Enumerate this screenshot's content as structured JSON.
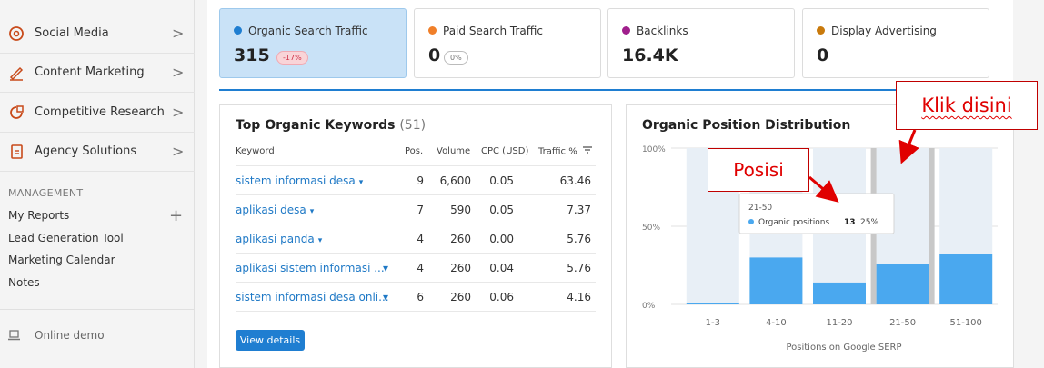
{
  "sidebar": {
    "items": [
      {
        "label": "Social Media",
        "icon": "social-media-icon",
        "chevron": ">"
      },
      {
        "label": "Content Marketing",
        "icon": "content-marketing-icon",
        "chevron": ">"
      },
      {
        "label": "Competitive Research",
        "icon": "competitive-research-icon",
        "chevron": ">"
      },
      {
        "label": "Agency Solutions",
        "icon": "agency-solutions-icon",
        "chevron": ">"
      }
    ],
    "management_label": "MANAGEMENT",
    "management_links": [
      "My Reports",
      "Lead Generation Tool",
      "Marketing Calendar",
      "Notes"
    ],
    "plus": "+",
    "online_demo": "Online demo"
  },
  "kpis": [
    {
      "label": "Organic Search Traffic",
      "value": "315",
      "change": "-17%",
      "dot_color": "#1f7ed1"
    },
    {
      "label": "Paid Search Traffic",
      "value": "0",
      "change": "0%",
      "dot_color": "#f07f29"
    },
    {
      "label": "Backlinks",
      "value": "16.4K",
      "change": "",
      "dot_color": "#a01f8c"
    },
    {
      "label": "Display Advertising",
      "value": "0",
      "change": "",
      "dot_color": "#c97a0c"
    }
  ],
  "keywords": {
    "title": "Top Organic Keywords",
    "count": "(51)",
    "headers": [
      "Keyword",
      "Pos.",
      "Volume",
      "CPC (USD)",
      "Traffic %"
    ],
    "rows": [
      {
        "keyword": "sistem informasi desa",
        "pos": "9",
        "volume": "6,600",
        "cpc": "0.05",
        "traffic": "63.46"
      },
      {
        "keyword": "aplikasi desa",
        "pos": "7",
        "volume": "590",
        "cpc": "0.05",
        "traffic": "7.37"
      },
      {
        "keyword": "aplikasi panda",
        "pos": "4",
        "volume": "260",
        "cpc": "0.00",
        "traffic": "5.76"
      },
      {
        "keyword": "aplikasi sistem informasi ...",
        "pos": "4",
        "volume": "260",
        "cpc": "0.04",
        "traffic": "5.76"
      },
      {
        "keyword": "sistem informasi desa onli...",
        "pos": "6",
        "volume": "260",
        "cpc": "0.06",
        "traffic": "4.16"
      }
    ],
    "caret": "▾",
    "button": "View details"
  },
  "distribution": {
    "title": "Organic Position Distribution"
  },
  "chart_data": {
    "type": "bar",
    "categories": [
      "1-3",
      "4-10",
      "11-20",
      "21-50",
      "51-100"
    ],
    "values": [
      1,
      30,
      14,
      26,
      32
    ],
    "ylim": [
      0,
      100
    ],
    "yticks": [
      "0%",
      "50%",
      "100%"
    ],
    "xlabel": "Positions on Google SERP",
    "tooltip": {
      "title": "21-50",
      "label": "Organic positions",
      "count": "13",
      "percent": "25%"
    },
    "colors": {
      "bar": "#4aa8ef",
      "background": "#e8eff6",
      "highlight": "#c8c8c8"
    }
  },
  "annotations": {
    "posisi": "Posisi",
    "klik": "Klik disini"
  }
}
